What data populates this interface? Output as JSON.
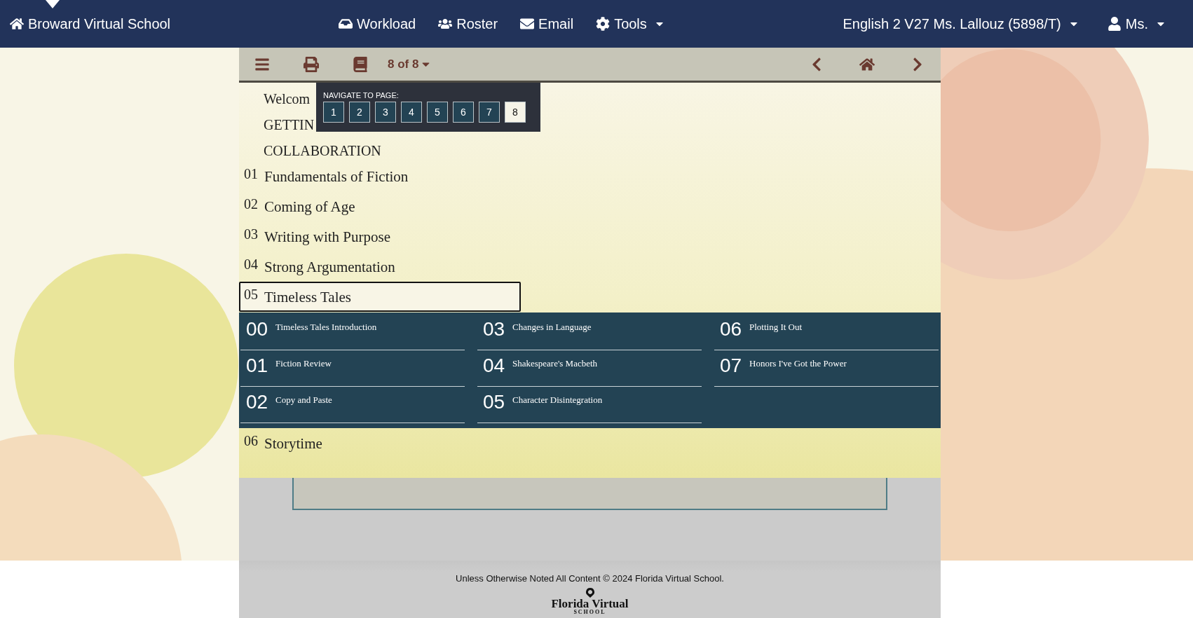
{
  "navbar": {
    "brand": "Broward Virtual School",
    "links": [
      {
        "label": "Workload",
        "dropdown": false
      },
      {
        "label": "Roster",
        "dropdown": false
      },
      {
        "label": "Email",
        "dropdown": false
      },
      {
        "label": "Tools",
        "dropdown": true
      }
    ],
    "course": {
      "label": "English 2 V27 Ms. Lallouz (5898/T)",
      "dropdown": true
    },
    "user": {
      "label": "Ms.",
      "dropdown": true
    }
  },
  "toolbar": {
    "page_indicator": "8 of 8"
  },
  "page_popup": {
    "title": "NAVIGATE TO PAGE:",
    "pages": [
      {
        "label": "1",
        "selected": false
      },
      {
        "label": "2",
        "selected": false
      },
      {
        "label": "3",
        "selected": false
      },
      {
        "label": "4",
        "selected": false
      },
      {
        "label": "5",
        "selected": false
      },
      {
        "label": "6",
        "selected": false
      },
      {
        "label": "7",
        "selected": false
      },
      {
        "label": "8",
        "selected": true
      }
    ]
  },
  "menu": {
    "intro_items": [
      "Welcom",
      "GETTIN",
      "COLLABORATION"
    ],
    "units": [
      {
        "number": "01",
        "title": "Fundamentals of Fiction",
        "selected": false
      },
      {
        "number": "02",
        "title": "Coming of Age",
        "selected": false
      },
      {
        "number": "03",
        "title": "Writing with Purpose",
        "selected": false
      },
      {
        "number": "04",
        "title": "Strong Argumentation",
        "selected": false
      },
      {
        "number": "05",
        "title": "Timeless Tales",
        "selected": true,
        "lessons": [
          {
            "number": "00",
            "title": "Timeless Tales Introduction"
          },
          {
            "number": "01",
            "title": "Fiction Review"
          },
          {
            "number": "02",
            "title": "Copy and Paste"
          },
          {
            "number": "03",
            "title": "Changes in Language"
          },
          {
            "number": "04",
            "title": "Shakespeare's Macbeth"
          },
          {
            "number": "05",
            "title": "Character Disintegration"
          },
          {
            "number": "06",
            "title": "Plotting It Out"
          },
          {
            "number": "07",
            "title": "Honors I've Got the Power"
          }
        ]
      },
      {
        "number": "06",
        "title": "Storytime",
        "selected": false
      }
    ]
  },
  "footer": {
    "copyright": "Unless Otherwise Noted All Content © 2024 Florida Virtual School.",
    "logo_name": "Florida Virtual",
    "logo_sub": "SCHOOL"
  }
}
